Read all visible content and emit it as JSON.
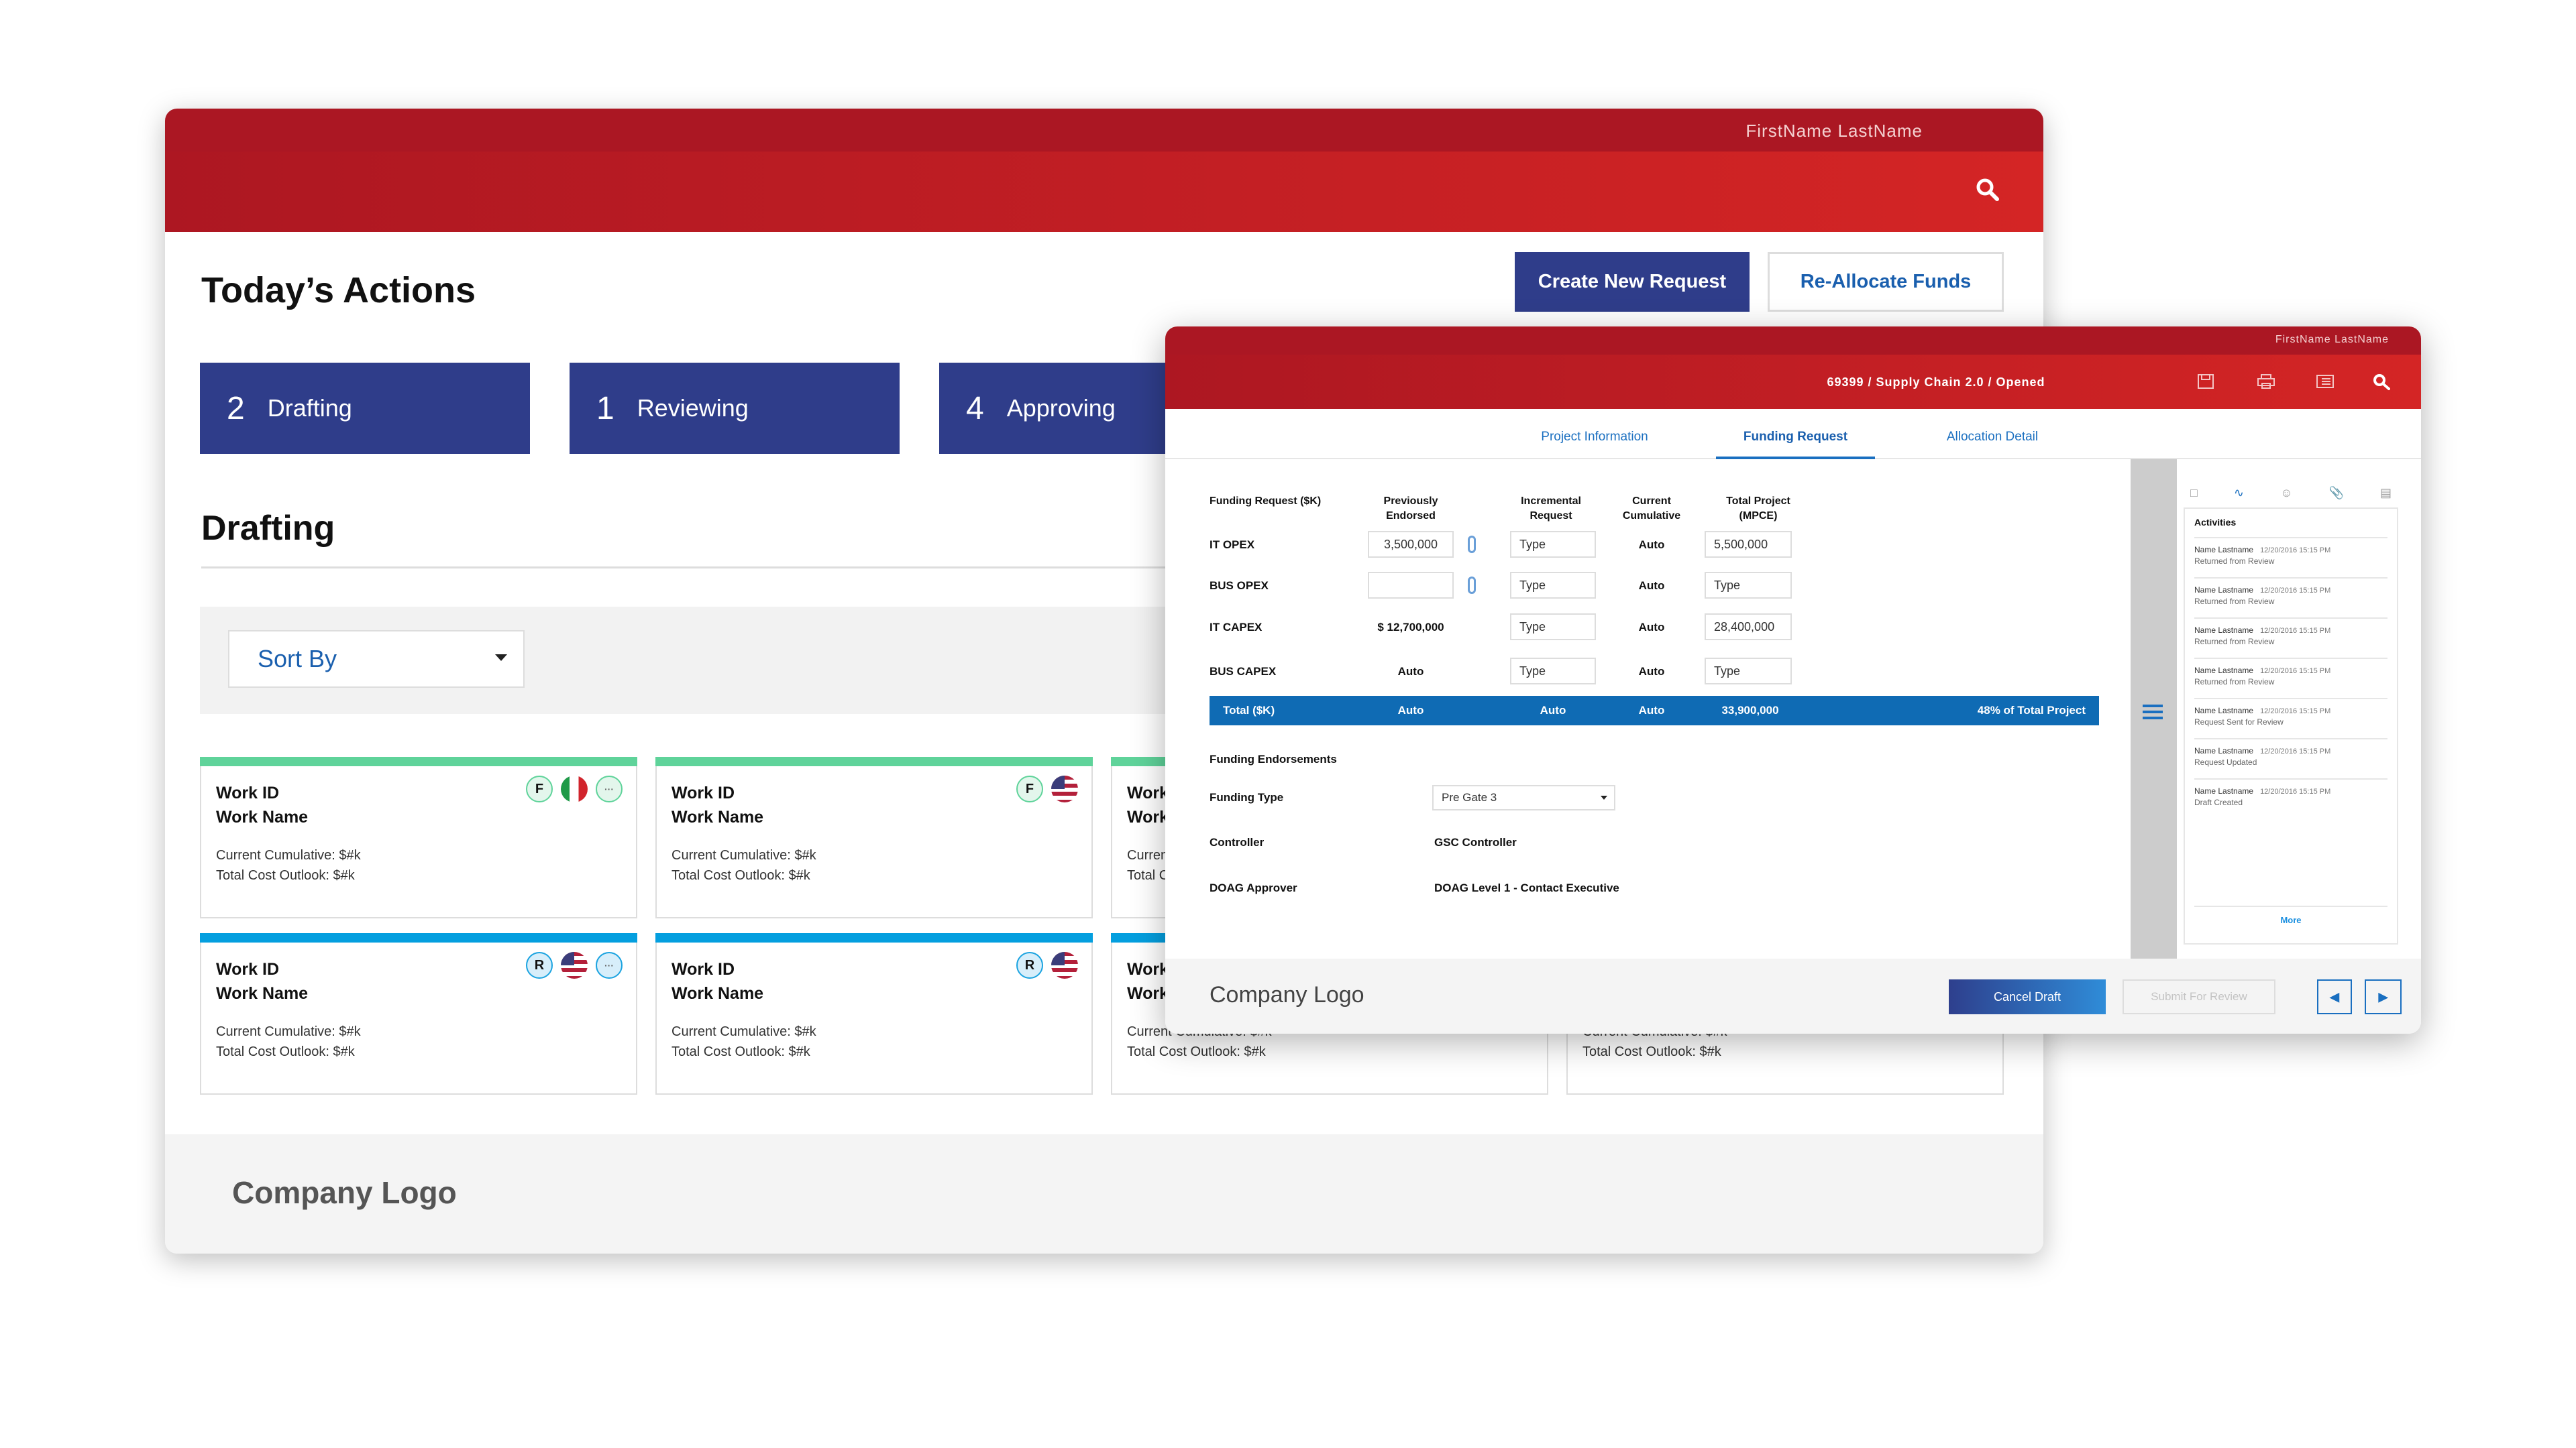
{
  "dashboard": {
    "user_name": "FirstName LastName",
    "page_title": "Today’s Actions",
    "create_button": "Create New Request",
    "reallocate_button": "Re-Allocate Funds",
    "status_tiles": [
      {
        "count": "2",
        "label": "Drafting"
      },
      {
        "count": "1",
        "label": "Reviewing"
      },
      {
        "count": "4",
        "label": "Approving"
      }
    ],
    "section_title": "Drafting",
    "sort_label": "Sort By",
    "cards": [
      {
        "id": "Work ID",
        "name": "Work Name",
        "cumulative": "Current Cumulative: $#k",
        "outlook": "Total Cost Outlook: $#k",
        "status": "F",
        "flag": "italy",
        "more": true,
        "color": "#5fd39a"
      },
      {
        "id": "Work ID",
        "name": "Work Name",
        "cumulative": "Current Cumulative: $#k",
        "outlook": "Total Cost Outlook: $#k",
        "status": "F",
        "flag": "usa",
        "more": false,
        "color": "#5fd39a"
      },
      {
        "id": "Work ID",
        "name": "Work Name",
        "cumulative": "Current Cumulative: $#k",
        "outlook": "Total Cost Outlook: $#k",
        "status": "F",
        "flag": "usa",
        "more": false,
        "color": "#5fd39a"
      },
      {
        "id": "Work ID",
        "name": "Work Name",
        "cumulative": "Current Cumulative: $#k",
        "outlook": "Total Cost Outlook: $#k",
        "status": "F",
        "flag": "usa",
        "more": false,
        "color": "#5fd39a"
      },
      {
        "id": "Work ID",
        "name": "Work Name",
        "cumulative": "Current Cumulative: $#k",
        "outlook": "Total Cost Outlook: $#k",
        "status": "R",
        "flag": "usa",
        "more": true,
        "color": "#049fdf"
      },
      {
        "id": "Work ID",
        "name": "Work Name",
        "cumulative": "Current Cumulative: $#k",
        "outlook": "Total Cost Outlook: $#k",
        "status": "R",
        "flag": "usa",
        "more": false,
        "color": "#049fdf"
      },
      {
        "id": "Work ID",
        "name": "Work Name",
        "cumulative": "Current Cumulative: $#k",
        "outlook": "Total Cost Outlook: $#k",
        "status": "R",
        "flag": "usa",
        "more": false,
        "color": "#049fdf"
      },
      {
        "id": "Work ID",
        "name": "Work Name",
        "cumulative": "Current Cumulative: $#k",
        "outlook": "Total Cost Outlook: $#k",
        "status": "R",
        "flag": "usa",
        "more": false,
        "color": "#049fdf"
      }
    ],
    "footer_logo": "Company Logo"
  },
  "detail": {
    "user_name": "FirstName LastName",
    "title": "69399 / Supply Chain 2.0 / Opened",
    "toolbar_icons": [
      "save-icon",
      "print-icon",
      "news-icon",
      "search-icon"
    ],
    "tabs": [
      "Project Information",
      "Funding Request",
      "Allocation Detail"
    ],
    "active_tab": "Funding Request",
    "table_headers": [
      "Funding Request ($K)",
      "Previously Endorsed",
      "Incremental Request",
      "Current Cumulative",
      "Total Project (MPCE)"
    ],
    "rows": [
      {
        "label": "IT OPEX",
        "endorsed": "3,500,000",
        "incremental": "Type",
        "cumulative": "Auto",
        "total": "5,500,000"
      },
      {
        "label": "BUS OPEX",
        "endorsed": "",
        "incremental": "Type",
        "cumulative": "Auto",
        "total": "Type"
      },
      {
        "label": "IT CAPEX",
        "endorsed": "$ 12,700,000",
        "incremental": "Type",
        "cumulative": "Auto",
        "total": "28,400,000"
      },
      {
        "label": "BUS CAPEX",
        "endorsed": "Auto",
        "incremental": "Type",
        "cumulative": "Auto",
        "total": "Type"
      }
    ],
    "total_row": {
      "label": "Total ($K)",
      "endorsed": "Auto",
      "incremental": "Auto",
      "cumulative": "Auto",
      "total": "33,900,000",
      "percent": "48% of Total Project"
    },
    "endorsements_title": "Funding Endorsements",
    "funding_type_label": "Funding Type",
    "funding_type_value": "Pre Gate 3",
    "controller_label": "Controller",
    "controller_value": "GSC Controller",
    "doag_label": "DOAG Approver",
    "doag_value": "DOAG Level 1 - Contact Executive",
    "activities_title": "Activities",
    "activities": [
      {
        "name": "Name Lastname",
        "time": "12/20/2016 15:15 PM",
        "action": "Returned from Review"
      },
      {
        "name": "Name Lastname",
        "time": "12/20/2016 15:15 PM",
        "action": "Returned from Review"
      },
      {
        "name": "Name Lastname",
        "time": "12/20/2016 15:15 PM",
        "action": "Returned from Review"
      },
      {
        "name": "Name Lastname",
        "time": "12/20/2016 15:15 PM",
        "action": "Returned from Review"
      },
      {
        "name": "Name Lastname",
        "time": "12/20/2016 15:15 PM",
        "action": "Request Sent for Review"
      },
      {
        "name": "Name Lastname",
        "time": "12/20/2016 15:15 PM",
        "action": "Request Updated"
      },
      {
        "name": "Name Lastname",
        "time": "12/20/2016 15:15 PM",
        "action": "Draft Created"
      }
    ],
    "more_link": "More",
    "footer_logo": "Company Logo",
    "cancel_button": "Cancel Draft",
    "submit_button": "Submit For Review"
  },
  "colors": {
    "header_red": "#d42525",
    "header_dark": "#ab1723",
    "tile_navy": "#2f3d8a",
    "accent_blue": "#0f6bb4",
    "funding_green": "#5fd39a",
    "reviewing_blue": "#049fdf"
  }
}
